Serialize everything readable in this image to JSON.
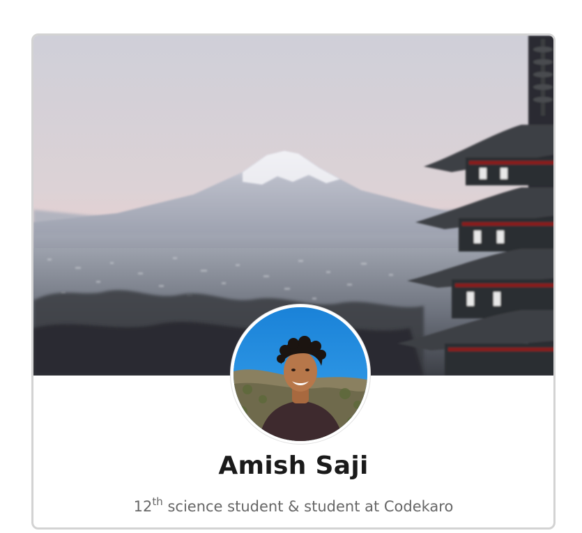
{
  "profile": {
    "name": "Amish Saji",
    "bio": {
      "grade": "12",
      "ordinal_suffix": "th",
      "rest": " science student & student at Codekaro"
    }
  },
  "images": {
    "cover": "mount-fuji-pagoda-cover-photo",
    "avatar": "profile-photo"
  },
  "colors": {
    "card_border": "#d3d3d3",
    "name_text": "#1a1a1a",
    "bio_text": "#666666"
  }
}
